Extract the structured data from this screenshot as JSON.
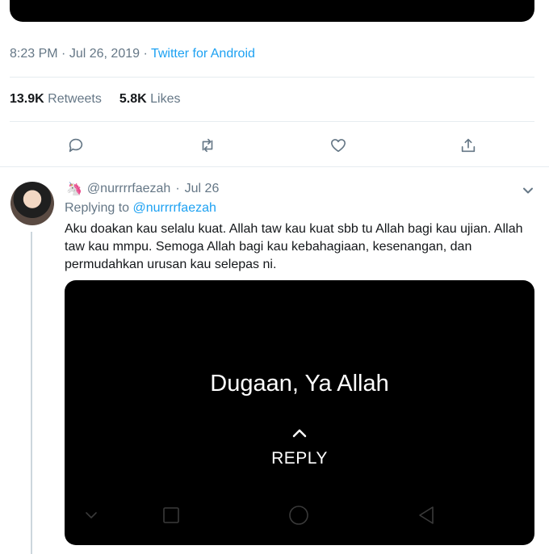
{
  "tweet": {
    "time": "8:23 PM",
    "date": "Jul 26, 2019",
    "separator": "·",
    "client": "Twitter for Android",
    "retweets_count": "13.9K",
    "retweets_label": "Retweets",
    "likes_count": "5.8K",
    "likes_label": "Likes"
  },
  "actions": {
    "reply_icon": "reply-icon",
    "retweet_icon": "retweet-icon",
    "like_icon": "heart-icon",
    "share_icon": "share-icon"
  },
  "reply": {
    "emoji": "🦄",
    "handle": "@nurrrrfaezah",
    "separator": "·",
    "date": "Jul 26",
    "replying_prefix": "Replying to",
    "replying_handle": "@nurrrrfaezah",
    "text": "Aku doakan kau selalu kuat. Allah taw kau kuat sbb tu Allah bagi kau ujian. Allah taw kau mmpu. Semoga Allah bagi kau kebahagiaan, kesenangan, dan permudahkan urusan kau selepas ni.",
    "media": {
      "headline": "Dugaan, Ya Allah",
      "reply_label": "REPLY"
    }
  },
  "colors": {
    "accent": "#1da1f2",
    "secondary_text": "#657786",
    "border": "#e6ecf0"
  }
}
